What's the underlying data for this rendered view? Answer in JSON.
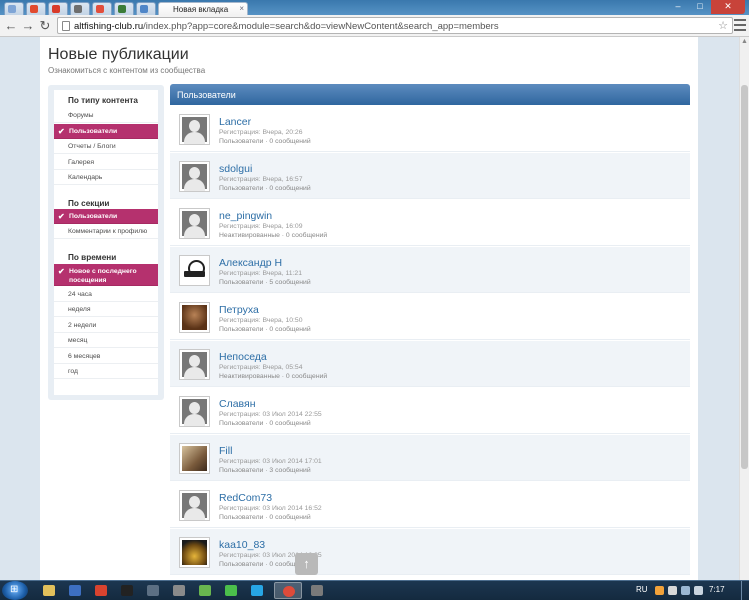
{
  "browser": {
    "active_tab_title": "Новая вкладка",
    "url_domain": "altfishing-club.ru",
    "url_path": "/index.php?app=core&module=search&do=viewNewContent&search_app=members",
    "window_minimize": "–",
    "window_maximize": "□",
    "window_close": "✕"
  },
  "page": {
    "title": "Новые публикации",
    "subtitle": "Ознакомиться с контентом из сообщества"
  },
  "sidebar": {
    "sections": [
      {
        "heading": "По типу контента",
        "items": [
          {
            "label": "Форумы",
            "active": false
          },
          {
            "label": "Пользователи",
            "active": true
          },
          {
            "label": "Отчеты / Блоги",
            "active": false
          },
          {
            "label": "Галерея",
            "active": false
          },
          {
            "label": "Календарь",
            "active": false
          }
        ]
      },
      {
        "heading": "По секции",
        "items": [
          {
            "label": "Пользователи",
            "active": true
          },
          {
            "label": "Комментарии к профилю",
            "active": false
          }
        ]
      },
      {
        "heading": "По времени",
        "items": [
          {
            "label": "Новое с последнего посещения",
            "active": true
          },
          {
            "label": "24 часа",
            "active": false
          },
          {
            "label": "неделя",
            "active": false
          },
          {
            "label": "2 недели",
            "active": false
          },
          {
            "label": "месяц",
            "active": false
          },
          {
            "label": "6 месяцев",
            "active": false
          },
          {
            "label": "год",
            "active": false
          }
        ]
      }
    ]
  },
  "panel": {
    "title": "Пользователи",
    "members": [
      {
        "name": "Lancer",
        "registered": "Регистрация: Вчера, 20:26",
        "group": "Пользователи · 0 сообщений",
        "avatar": "default"
      },
      {
        "name": "sdolgui",
        "registered": "Регистрация: Вчера, 16:57",
        "group": "Пользователи · 0 сообщений",
        "avatar": "default"
      },
      {
        "name": "ne_pingwin",
        "registered": "Регистрация: Вчера, 16:09",
        "group": "Неактивированные · 0 сообщений",
        "avatar": "default"
      },
      {
        "name": "Александр Н",
        "registered": "Регистрация: Вчера, 11:21",
        "group": "Пользователи · 5 сообщений",
        "avatar": "logo"
      },
      {
        "name": "Петруха",
        "registered": "Регистрация: Вчера, 10:50",
        "group": "Пользователи · 0 сообщений",
        "avatar": "photo-dark"
      },
      {
        "name": "Непоседа",
        "registered": "Регистрация: Вчера, 05:54",
        "group": "Неактивированные · 0 сообщений",
        "avatar": "default"
      },
      {
        "name": "Славян",
        "registered": "Регистрация: 03 Июл 2014 22:55",
        "group": "Пользователи · 0 сообщений",
        "avatar": "default"
      },
      {
        "name": "Fill",
        "registered": "Регистрация: 03 Июл 2014 17:01",
        "group": "Пользователи · 3 сообщений",
        "avatar": "photo-gym"
      },
      {
        "name": "RedCom73",
        "registered": "Регистрация: 03 Июл 2014 16:52",
        "group": "Пользователи · 0 сообщений",
        "avatar": "default"
      },
      {
        "name": "kaa10_83",
        "registered": "Регистрация: 03 Июл 2014 16:35",
        "group": "Пользователи · 0 сообщений",
        "avatar": "photo-gold"
      }
    ]
  },
  "back_to_top_label": "↑",
  "taskbar": {
    "language": "RU",
    "time": "7:17"
  },
  "colors": {
    "accent": "#b5316e",
    "link": "#2d6ea6",
    "header_bar": "#2f669f"
  }
}
